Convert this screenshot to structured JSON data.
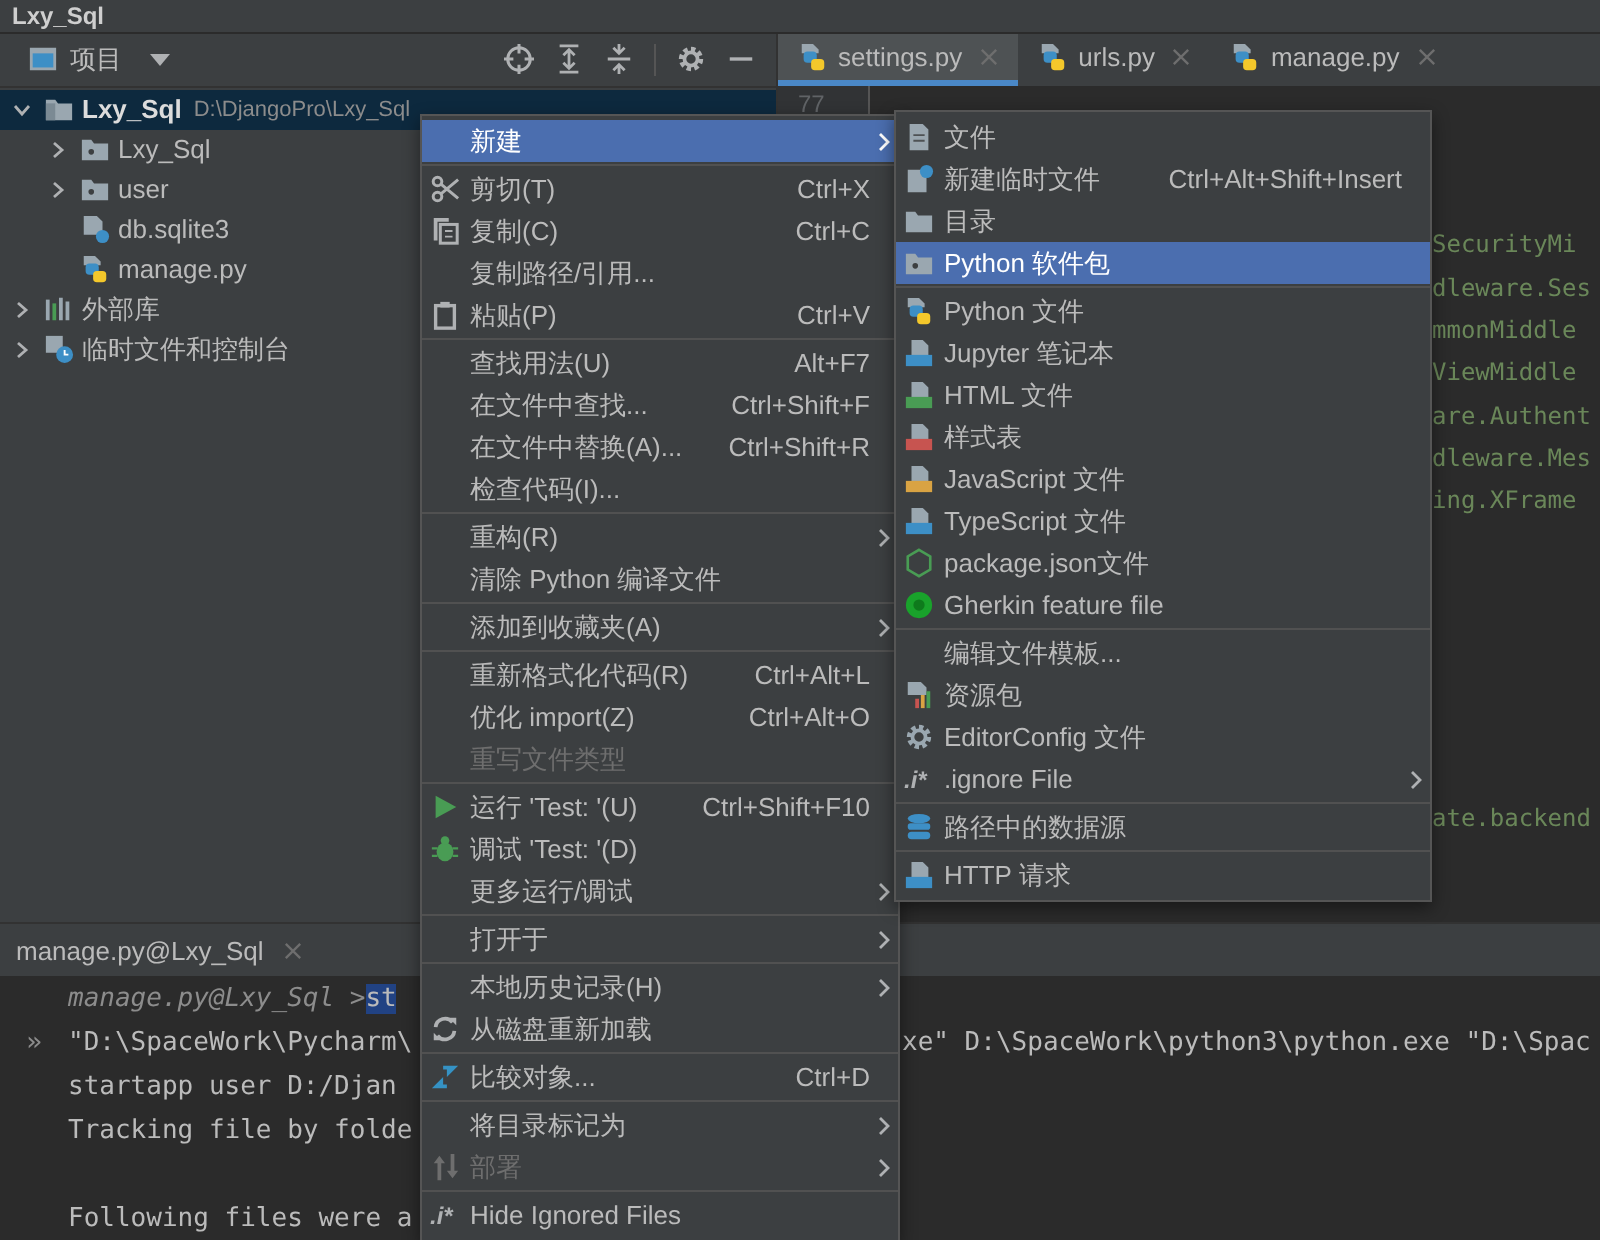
{
  "window": {
    "title": "Lxy_Sql"
  },
  "project_panel": {
    "title": "项目",
    "tree": [
      {
        "label": "Lxy_Sql",
        "hint": "D:\\DjangoPro\\Lxy_Sql",
        "kind": "module",
        "expanded": true,
        "selected": true,
        "children": [
          {
            "label": "Lxy_Sql",
            "kind": "folder",
            "expanded": false,
            "selected": false
          },
          {
            "label": "user",
            "kind": "folder",
            "expanded": false,
            "selected": false
          },
          {
            "label": "db.sqlite3",
            "kind": "unknown",
            "selected": false
          },
          {
            "label": "manage.py",
            "kind": "python",
            "selected": false
          }
        ]
      },
      {
        "label": "外部库",
        "kind": "library",
        "expanded": false,
        "selected": false
      },
      {
        "label": "临时文件和控制台",
        "kind": "scratches",
        "expanded": false,
        "selected": false
      }
    ]
  },
  "editor": {
    "tabs": [
      {
        "label": "settings.py",
        "selected": true
      },
      {
        "label": "urls.py",
        "selected": false
      },
      {
        "label": "manage.py",
        "selected": false
      }
    ],
    "line_number": "77",
    "code_upper": [
      "SecurityMi",
      "dleware.Ses",
      "mmonMiddle",
      "ViewMiddle",
      "are.Authent",
      "dleware.Mes",
      "ing.XFrame"
    ],
    "code_lower": [
      "ate.backend"
    ]
  },
  "run_panel": {
    "tab": "manage.py@Lxy_Sql",
    "lines": [
      {
        "kind": "command",
        "prompt": "manage.py@Lxy_Sql >",
        "command": "st",
        "selected": true
      },
      {
        "kind": "output",
        "marker": "»",
        "text": "\"D:\\SpaceWork\\Pycharm\\",
        "rest": "xe\" D:\\SpaceWork\\python3\\python.exe \"D:\\Spac"
      },
      {
        "kind": "output",
        "text": " startapp user D:/Djan"
      },
      {
        "kind": "output",
        "text": "Tracking file by folde"
      },
      {
        "kind": "blank"
      },
      {
        "kind": "output",
        "text": "Following files were a"
      }
    ]
  },
  "context_menu": {
    "items": [
      {
        "kind": "item",
        "label": "新建",
        "selected": true,
        "disabled": false,
        "submenu": true
      },
      {
        "kind": "separator"
      },
      {
        "kind": "item",
        "label": "剪切(T)",
        "shortcut": "Ctrl+X",
        "selected": false,
        "disabled": false,
        "submenu": false
      },
      {
        "kind": "item",
        "label": "复制(C)",
        "shortcut": "Ctrl+C",
        "selected": false,
        "disabled": false,
        "submenu": false
      },
      {
        "kind": "item",
        "label": "复制路径/引用...",
        "selected": false,
        "disabled": false,
        "submenu": false
      },
      {
        "kind": "item",
        "label": "粘贴(P)",
        "shortcut": "Ctrl+V",
        "selected": false,
        "disabled": false,
        "submenu": false
      },
      {
        "kind": "separator"
      },
      {
        "kind": "item",
        "label": "查找用法(U)",
        "shortcut": "Alt+F7",
        "selected": false,
        "disabled": false,
        "submenu": false
      },
      {
        "kind": "item",
        "label": "在文件中查找...",
        "shortcut": "Ctrl+Shift+F",
        "selected": false,
        "disabled": false,
        "submenu": false
      },
      {
        "kind": "item",
        "label": "在文件中替换(A)...",
        "shortcut": "Ctrl+Shift+R",
        "selected": false,
        "disabled": false,
        "submenu": false
      },
      {
        "kind": "item",
        "label": "检查代码(I)...",
        "selected": false,
        "disabled": false,
        "submenu": false
      },
      {
        "kind": "separator"
      },
      {
        "kind": "item",
        "label": "重构(R)",
        "selected": false,
        "disabled": false,
        "submenu": true
      },
      {
        "kind": "item",
        "label": "清除 Python 编译文件",
        "selected": false,
        "disabled": false,
        "submenu": false
      },
      {
        "kind": "separator"
      },
      {
        "kind": "item",
        "label": "添加到收藏夹(A)",
        "selected": false,
        "disabled": false,
        "submenu": true
      },
      {
        "kind": "separator"
      },
      {
        "kind": "item",
        "label": "重新格式化代码(R)",
        "shortcut": "Ctrl+Alt+L",
        "selected": false,
        "disabled": false,
        "submenu": false
      },
      {
        "kind": "item",
        "label": "优化 import(Z)",
        "shortcut": "Ctrl+Alt+O",
        "selected": false,
        "disabled": false,
        "submenu": false
      },
      {
        "kind": "item",
        "label": "重写文件类型",
        "selected": false,
        "disabled": true,
        "submenu": false
      },
      {
        "kind": "separator"
      },
      {
        "kind": "item",
        "label": "运行 'Test: '(U)",
        "shortcut": "Ctrl+Shift+F10",
        "selected": false,
        "disabled": false,
        "submenu": false
      },
      {
        "kind": "item",
        "label": "调试 'Test: '(D)",
        "selected": false,
        "disabled": false,
        "submenu": false
      },
      {
        "kind": "item",
        "label": "更多运行/调试",
        "selected": false,
        "disabled": false,
        "submenu": true
      },
      {
        "kind": "separator"
      },
      {
        "kind": "item",
        "label": "打开于",
        "selected": false,
        "disabled": false,
        "submenu": true
      },
      {
        "kind": "separator"
      },
      {
        "kind": "item",
        "label": "本地历史记录(H)",
        "selected": false,
        "disabled": false,
        "submenu": true
      },
      {
        "kind": "item",
        "label": "从磁盘重新加载",
        "selected": false,
        "disabled": false,
        "submenu": false
      },
      {
        "kind": "separator"
      },
      {
        "kind": "item",
        "label": "比较对象...",
        "shortcut": "Ctrl+D",
        "selected": false,
        "disabled": false,
        "submenu": false
      },
      {
        "kind": "separator"
      },
      {
        "kind": "item",
        "label": "将目录标记为",
        "selected": false,
        "disabled": false,
        "submenu": true
      },
      {
        "kind": "item",
        "label": "部署",
        "selected": false,
        "disabled": true,
        "submenu": true
      },
      {
        "kind": "separator"
      },
      {
        "kind": "item",
        "label": "Hide Ignored Files",
        "glyph": ".i*",
        "selected": false,
        "disabled": false,
        "submenu": false
      }
    ]
  },
  "new_submenu": {
    "items": [
      {
        "kind": "item",
        "label": "文件",
        "selected": false,
        "submenu": false
      },
      {
        "kind": "item",
        "label": "新建临时文件",
        "shortcut": "Ctrl+Alt+Shift+Insert",
        "selected": false,
        "submenu": false
      },
      {
        "kind": "item",
        "label": "目录",
        "selected": false,
        "submenu": false
      },
      {
        "kind": "item",
        "label": "Python 软件包",
        "selected": true,
        "submenu": false
      },
      {
        "kind": "separator"
      },
      {
        "kind": "item",
        "label": "Python 文件",
        "selected": false,
        "submenu": false
      },
      {
        "kind": "item",
        "label": "Jupyter 笔记本",
        "selected": false,
        "submenu": false
      },
      {
        "kind": "item",
        "label": "HTML 文件",
        "selected": false,
        "submenu": false
      },
      {
        "kind": "item",
        "label": "样式表",
        "selected": false,
        "submenu": false
      },
      {
        "kind": "item",
        "label": "JavaScript 文件",
        "selected": false,
        "submenu": false
      },
      {
        "kind": "item",
        "label": "TypeScript 文件",
        "selected": false,
        "submenu": false
      },
      {
        "kind": "item",
        "label": "package.json文件",
        "selected": false,
        "submenu": false
      },
      {
        "kind": "item",
        "label": "Gherkin feature file",
        "selected": false,
        "submenu": false
      },
      {
        "kind": "separator"
      },
      {
        "kind": "item",
        "label": "编辑文件模板...",
        "selected": false,
        "submenu": false
      },
      {
        "kind": "item",
        "label": "资源包",
        "selected": false,
        "submenu": false
      },
      {
        "kind": "item",
        "label": "EditorConfig 文件",
        "selected": false,
        "submenu": false
      },
      {
        "kind": "item",
        "label": ".ignore File",
        "glyph": ".i*",
        "selected": false,
        "submenu": true
      },
      {
        "kind": "separator"
      },
      {
        "kind": "item",
        "label": "路径中的数据源",
        "selected": false,
        "submenu": false
      },
      {
        "kind": "separator"
      },
      {
        "kind": "item",
        "label": "HTTP 请求",
        "selected": false,
        "submenu": false
      }
    ]
  }
}
